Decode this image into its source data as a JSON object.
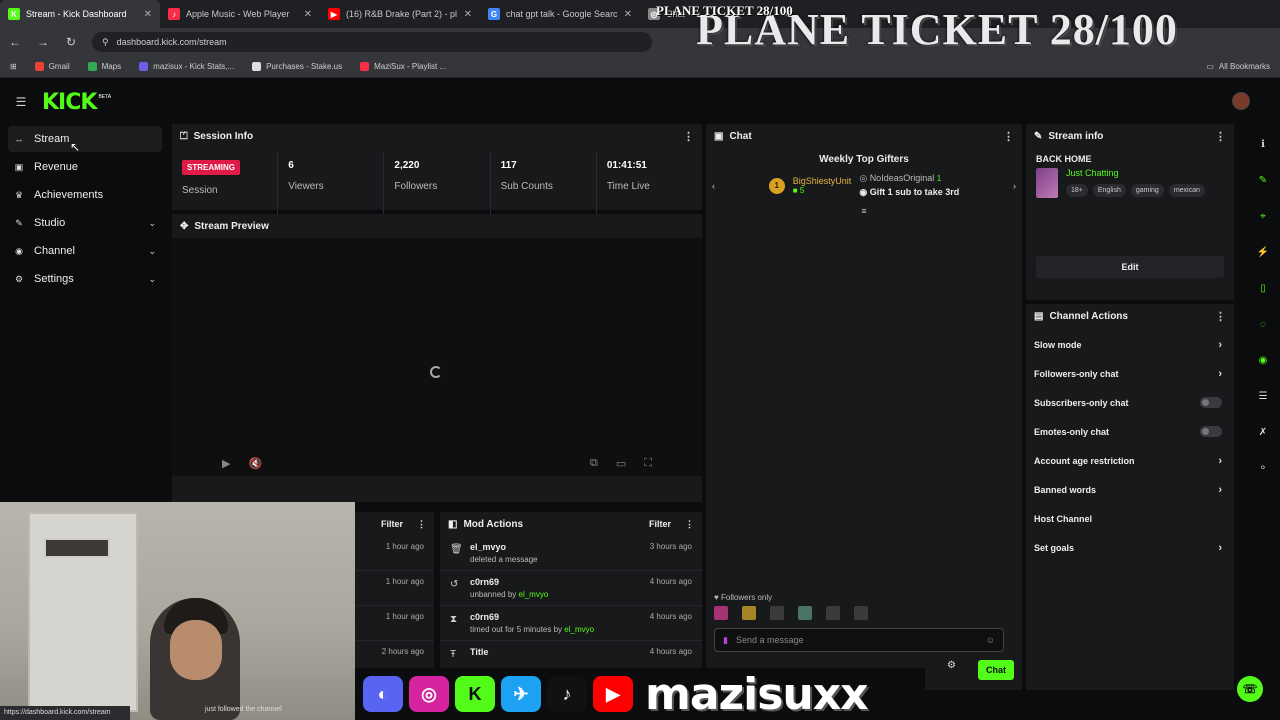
{
  "browser": {
    "tabs": [
      {
        "title": "Stream - Kick Dashboard",
        "fav_color": "#53fc18",
        "fav_letter": "K"
      },
      {
        "title": "Apple Music - Web Player",
        "fav_color": "#fa2d48",
        "fav_letter": "♪"
      },
      {
        "title": "(16) R&B Drake (Part 2) - pl",
        "fav_color": "#ff0000",
        "fav_letter": "▶"
      },
      {
        "title": "chat gpt talk - Google Search",
        "fav_color": "#4285f4",
        "fav_letter": "G"
      },
      {
        "title": "Chat",
        "fav_color": "#888888",
        "fav_letter": "◎"
      }
    ],
    "url": "dashboard.kick.com/stream",
    "bookmarks": [
      "Gmail",
      "Maps",
      "mazisux - Kick Stats,...",
      "Purchases - Stake.us",
      "MaziSux - Playlist ..."
    ],
    "bookmark_colors": [
      "#ea4335",
      "#34a853",
      "#6c5ce7",
      "#dddddd",
      "#fa2d48"
    ],
    "all_bookmarks": "All Bookmarks",
    "status_url": "https://dashboard.kick.com/stream"
  },
  "overlay": {
    "title_large": "PLANE TICKET 28/100",
    "title_small": "PLANE TICKET 28/100",
    "brand": "mazisuxx",
    "follow_note": "just followed the channel"
  },
  "app": {
    "logo": "KICK",
    "beta": "BETA"
  },
  "sidebar": {
    "items": [
      {
        "label": "Stream",
        "icon": "↔",
        "chevron": false
      },
      {
        "label": "Revenue",
        "icon": "▣",
        "chevron": false
      },
      {
        "label": "Achievements",
        "icon": "♛",
        "chevron": false
      },
      {
        "label": "Studio",
        "icon": "✎",
        "chevron": true
      },
      {
        "label": "Channel",
        "icon": "◉",
        "chevron": true
      },
      {
        "label": "Settings",
        "icon": "⚙",
        "chevron": true
      }
    ]
  },
  "session": {
    "title": "Session Info",
    "badge": "STREAMING",
    "session_label": "Session",
    "stats": [
      {
        "value": "6",
        "label": "Viewers"
      },
      {
        "value": "2,220",
        "label": "Followers"
      },
      {
        "value": "117",
        "label": "Sub Counts"
      },
      {
        "value": "01:41:51",
        "label": "Time Live"
      }
    ]
  },
  "preview": {
    "title": "Stream Preview"
  },
  "chat": {
    "title": "Chat",
    "gifters_title": "Weekly Top Gifters",
    "gifter_rank": "1",
    "gifter_name": "BigShiestyUnit",
    "gifter_subs": "5",
    "gifter2_name": "NoIdeasOriginal",
    "gifter2_subs": "1",
    "gift_prompt": "Gift 1 sub to take 3rd",
    "followers_only": "Followers only",
    "placeholder": "Send a message",
    "send_label": "Chat"
  },
  "stream_info": {
    "title": "Stream info",
    "stream_title": "BACK HOME",
    "category": "Just Chatting",
    "tags": [
      "18+",
      "English",
      "gaming",
      "mexican"
    ],
    "edit_label": "Edit"
  },
  "channel_actions": {
    "title": "Channel Actions",
    "items": [
      {
        "label": "Slow mode",
        "kind": "arrow"
      },
      {
        "label": "Followers-only chat",
        "kind": "arrow"
      },
      {
        "label": "Subscribers-only chat",
        "kind": "toggle"
      },
      {
        "label": "Emotes-only chat",
        "kind": "toggle"
      },
      {
        "label": "Account age restriction",
        "kind": "arrow"
      },
      {
        "label": "Banned words",
        "kind": "arrow"
      },
      {
        "label": "Host Channel",
        "kind": "none"
      },
      {
        "label": "Set goals",
        "kind": "arrow"
      }
    ]
  },
  "activity": {
    "filter_label": "Filter",
    "times": [
      "1 hour ago",
      "1 hour ago",
      "1 hour ago",
      "2 hours ago"
    ]
  },
  "mod_actions": {
    "title": "Mod Actions",
    "filter_label": "Filter",
    "rows": [
      {
        "icon": "🗑",
        "user": "el_mvyo",
        "desc": "deleted a message",
        "by": "",
        "time": "3 hours ago"
      },
      {
        "icon": "↺",
        "user": "c0rn69",
        "desc": "unbanned by",
        "by": "el_mvyo",
        "time": "4 hours ago"
      },
      {
        "icon": "⧗",
        "user": "c0rn69",
        "desc": "timed out for 5 minutes by",
        "by": "el_mvyo",
        "time": "4 hours ago"
      },
      {
        "icon": "Ŧ",
        "user": "Title",
        "desc": "",
        "by": "",
        "time": "4 hours ago"
      }
    ]
  }
}
